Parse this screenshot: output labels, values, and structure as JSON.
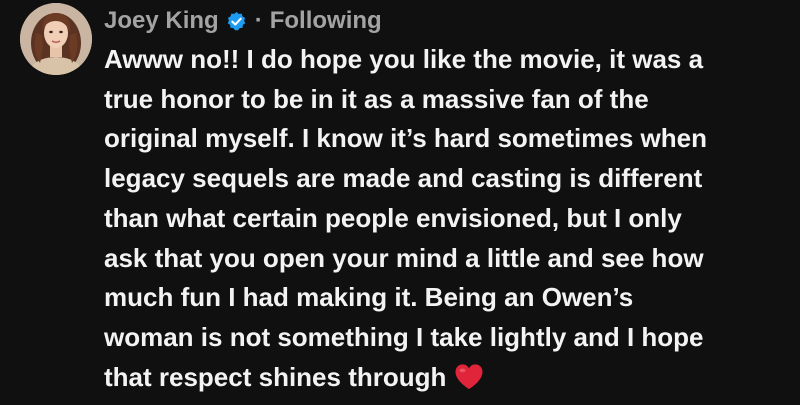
{
  "author": {
    "name": "Joey King",
    "verified_icon": "verified-check-icon",
    "separator": "·",
    "follow_status": "Following",
    "avatar_icon": "profile-photo"
  },
  "post": {
    "lines": [
      "Awww no!! I do hope you like the movie, it was a",
      "true honor to be in it as a massive fan of the",
      "original myself. I know it’s hard sometimes when",
      "legacy sequels are made and casting is different",
      "than what certain people envisioned, but I only",
      "ask that you open your mind a little and see how",
      "much fun I had making it. Being an Owen’s",
      "woman is not something I take lightly and I hope",
      "that respect shines through"
    ],
    "trailing_emoji": "red-heart-icon"
  },
  "colors": {
    "background": "#101010",
    "text": "#f3f3f3",
    "secondary": "#a3a3a3",
    "verified_badge": "#1d9bf0",
    "heart": "#e0243a"
  }
}
